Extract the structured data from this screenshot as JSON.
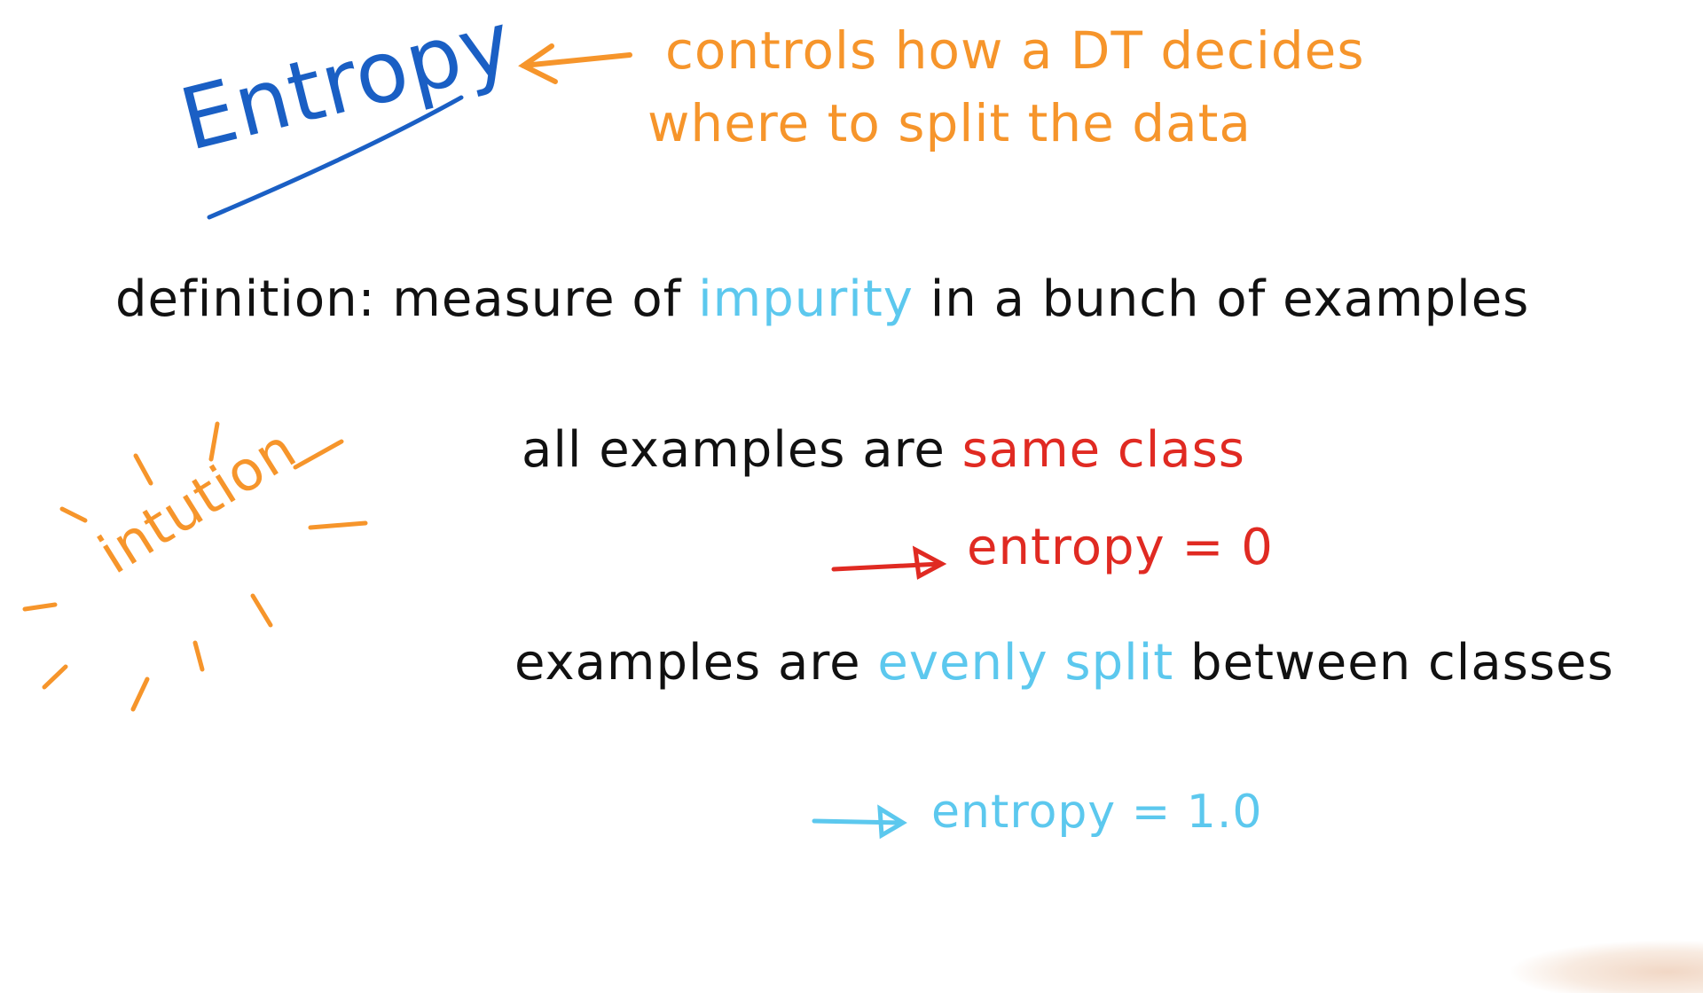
{
  "title": "Entropy",
  "subtitle": {
    "line1": "controls how a DT decides",
    "line2": "where to split the data"
  },
  "definition": {
    "label": "definition:",
    "pre": "measure of",
    "highlight": "impurity",
    "post": "in a bunch of examples"
  },
  "intuition_label": "intution",
  "case_pure": {
    "pre": "all examples are",
    "highlight": "same class",
    "result_label": "entropy",
    "result_value": "= 0"
  },
  "case_split": {
    "pre": "examples are",
    "highlight": "evenly split",
    "post": "between classes",
    "result_label": "entropy",
    "result_value": "= 1.0"
  },
  "colors": {
    "title": "#1a5fc4",
    "annotation": "#f6952b",
    "text": "#111111",
    "highlight_cyan": "#5cc8ee",
    "highlight_red": "#e02a22"
  },
  "icons": [
    "arrow-left-icon",
    "arrow-right-icon",
    "burst-icon",
    "underline-stroke"
  ]
}
